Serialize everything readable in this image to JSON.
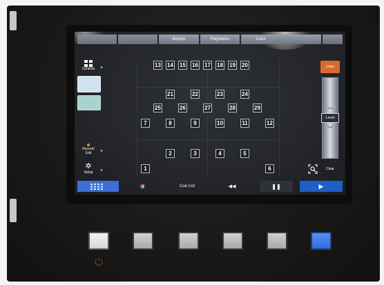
{
  "top_tabs": [
    "",
    "",
    "Bumps",
    "Playbacks",
    "Cues",
    "",
    ""
  ],
  "sidebar": {
    "controls": "Controls",
    "record_edit": "Record/\nEdit",
    "setup": "Setup"
  },
  "fixtures": [
    "13",
    "14",
    "15",
    "16",
    "17",
    "18",
    "19",
    "20",
    "21",
    "22",
    "23",
    "24",
    "25",
    "26",
    "27",
    "28",
    "29",
    "7",
    "8",
    "9",
    "10",
    "11",
    "12",
    "2",
    "3",
    "4",
    "5",
    "1",
    "6"
  ],
  "right_panel": {
    "undo": "Undo",
    "level": "Level",
    "level_value": 0.5,
    "clear": "Clear"
  },
  "bottom_bar": {
    "cue_list": "Cue List",
    "rewind_glyph": "◀◀",
    "pause_glyph": "❚❚",
    "play_glyph": "▶"
  },
  "colors": {
    "undo": "#d86a2c",
    "play": "#1f5ec9",
    "screen": "#24262b",
    "hw_blue": "#2d6de0"
  },
  "icons": [
    "grid-icon",
    "gear-icon",
    "record-dot-icon",
    "color-wheel-icon",
    "locate-icon",
    "power-icon"
  ]
}
